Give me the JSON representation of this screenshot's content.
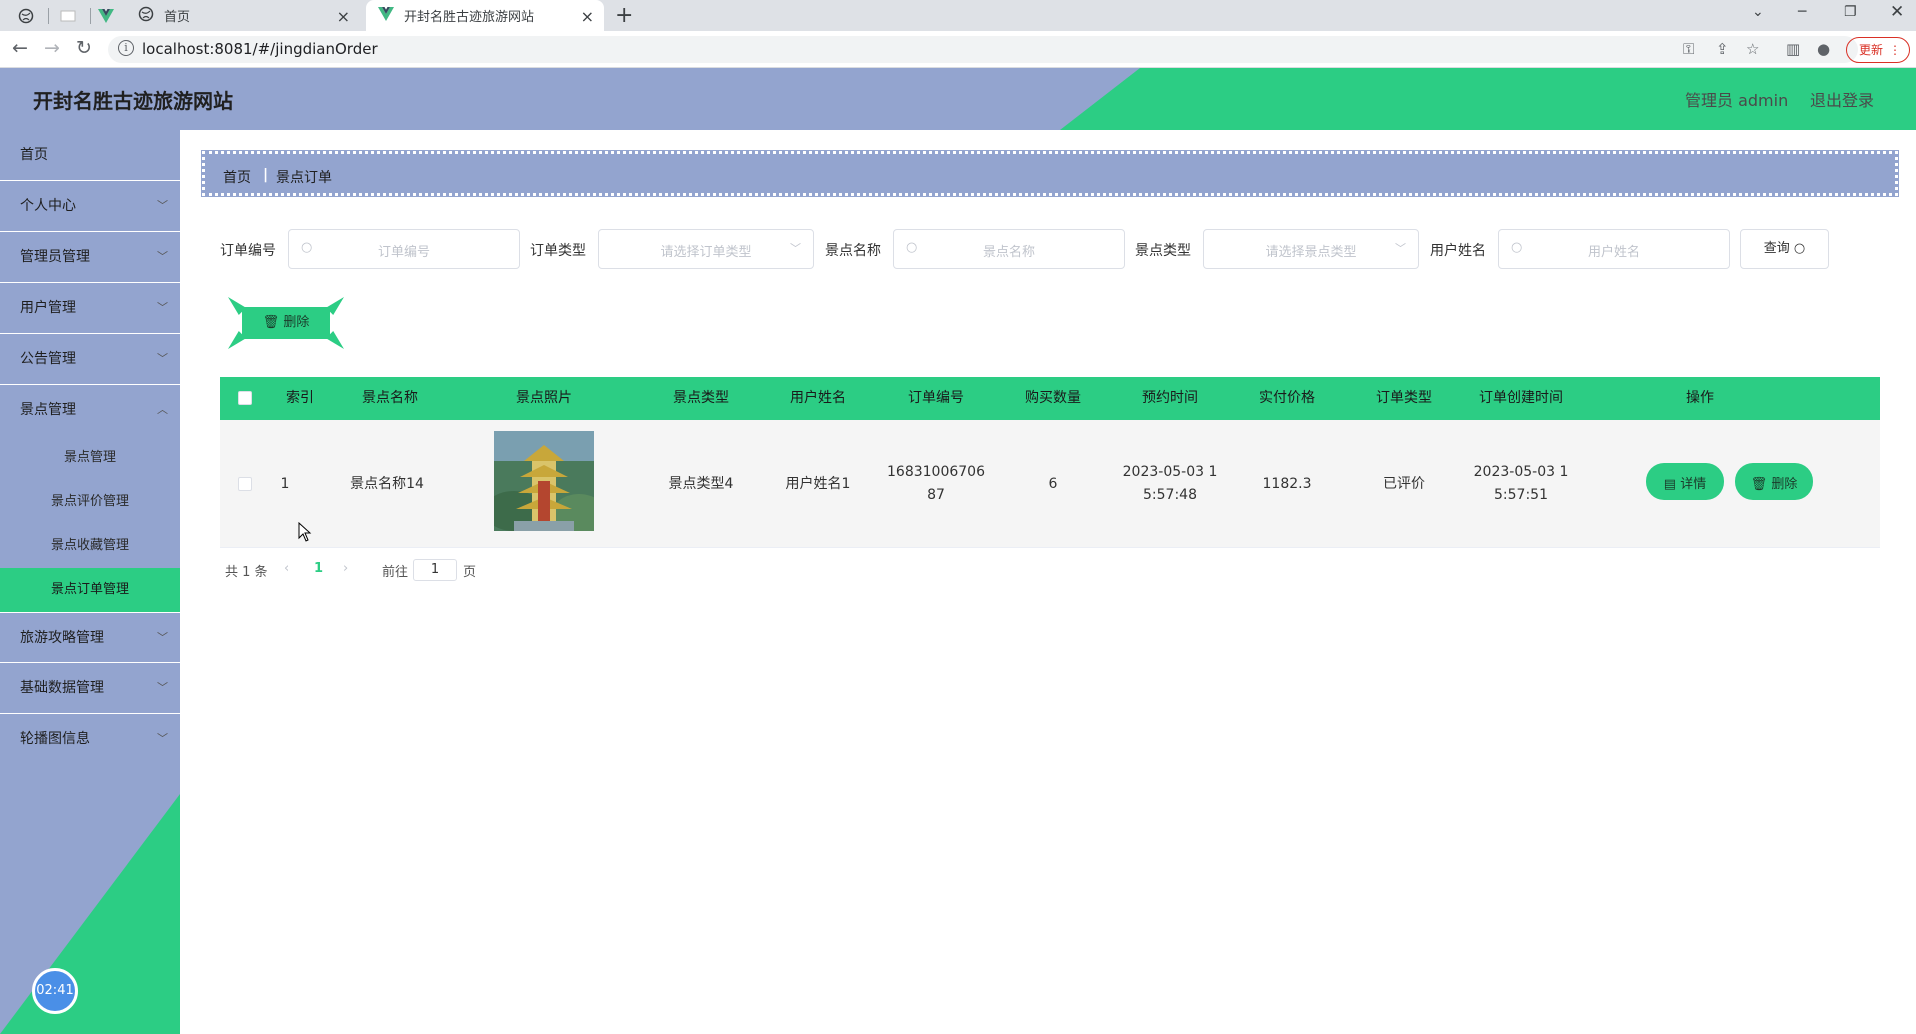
{
  "browser": {
    "tabs": [
      {
        "label": "首页"
      },
      {
        "label": "开封名胜古迹旅游网站"
      }
    ],
    "url": "localhost:8081/#/jingdianOrder",
    "update_label": "更新"
  },
  "header": {
    "title": "开封名胜古迹旅游网站",
    "admin": "管理员 admin",
    "logout": "退出登录"
  },
  "sidebar": {
    "items": [
      {
        "label": "首页"
      },
      {
        "label": "个人中心"
      },
      {
        "label": "管理员管理"
      },
      {
        "label": "用户管理"
      },
      {
        "label": "公告管理"
      },
      {
        "label": "景点管理"
      }
    ],
    "subitems": [
      {
        "label": "景点管理"
      },
      {
        "label": "景点评价管理"
      },
      {
        "label": "景点收藏管理"
      },
      {
        "label": "景点订单管理"
      }
    ],
    "items_after": [
      {
        "label": "旅游攻略管理"
      },
      {
        "label": "基础数据管理"
      },
      {
        "label": "轮播图信息"
      }
    ],
    "clock": "02:41"
  },
  "breadcrumb": {
    "home": "首页",
    "current": "景点订单"
  },
  "filters": {
    "order_no_label": "订单编号",
    "order_no_placeholder": "订单编号",
    "order_type_label": "订单类型",
    "order_type_placeholder": "请选择订单类型",
    "spot_name_label": "景点名称",
    "spot_name_placeholder": "景点名称",
    "spot_type_label": "景点类型",
    "spot_type_placeholder": "请选择景点类型",
    "user_name_label": "用户姓名",
    "user_name_placeholder": "用户姓名",
    "query_label": "查询"
  },
  "toolbar": {
    "delete_label": "删除"
  },
  "table": {
    "headers": [
      "索引",
      "景点名称",
      "景点照片",
      "景点类型",
      "用户姓名",
      "订单编号",
      "购买数量",
      "预约时间",
      "实付价格",
      "订单类型",
      "订单创建时间",
      "操作"
    ],
    "rows": [
      {
        "index": "1",
        "spot_name": "景点名称14",
        "spot_type": "景点类型4",
        "user_name": "用户姓名1",
        "order_no_line1": "16831006706",
        "order_no_line2": "87",
        "quantity": "6",
        "reserve_line1": "2023-05-03 1",
        "reserve_line2": "5:57:48",
        "price": "1182.3",
        "order_type": "已评价",
        "created_line1": "2023-05-03 1",
        "created_line2": "5:57:51",
        "detail_label": "详情",
        "delete_label": "删除"
      }
    ]
  },
  "pagination": {
    "total": "共 1 条",
    "current": "1",
    "goto": "前往",
    "page_value": "1",
    "page_unit": "页"
  },
  "colors": {
    "accent": "#2ccd84",
    "nav": "#93a4cf"
  }
}
